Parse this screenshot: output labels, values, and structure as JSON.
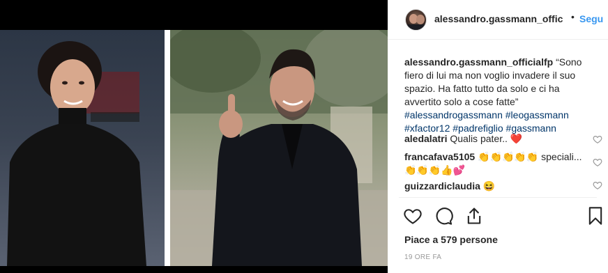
{
  "post": {
    "author": "alessandro.gassmann_offic",
    "separator": "•",
    "follow_label": "Segu"
  },
  "caption": {
    "user": "alessandro.gassmann_officialfp",
    "text": " “Sono fiero di lui ma non voglio invadere il suo spazio. Ha fatto tutto da solo e ci ha avvertito solo a cose fatte”",
    "hashtags": "#alessandrogassmann #leogassmann #xfactor12 #padrefiglio #gassmann"
  },
  "comments": [
    {
      "user": "aledalatri",
      "text": " Qualis pater.. ❤️"
    },
    {
      "user": "francafava5105",
      "text": " 👏👏👏👏👏 speciali...👏👏👏👍💕"
    },
    {
      "user": "guizzardiclaudia",
      "text": " 😆"
    }
  ],
  "likes_label": "Piace a 579 persone",
  "time_label": "19 ORE FA",
  "icons": {
    "like": "heart-icon",
    "comment": "comment-icon",
    "share": "share-icon",
    "save": "bookmark-icon"
  },
  "colors": {
    "link": "#3897f0",
    "hashtag": "#003569",
    "text": "#262626",
    "muted": "#999999"
  }
}
